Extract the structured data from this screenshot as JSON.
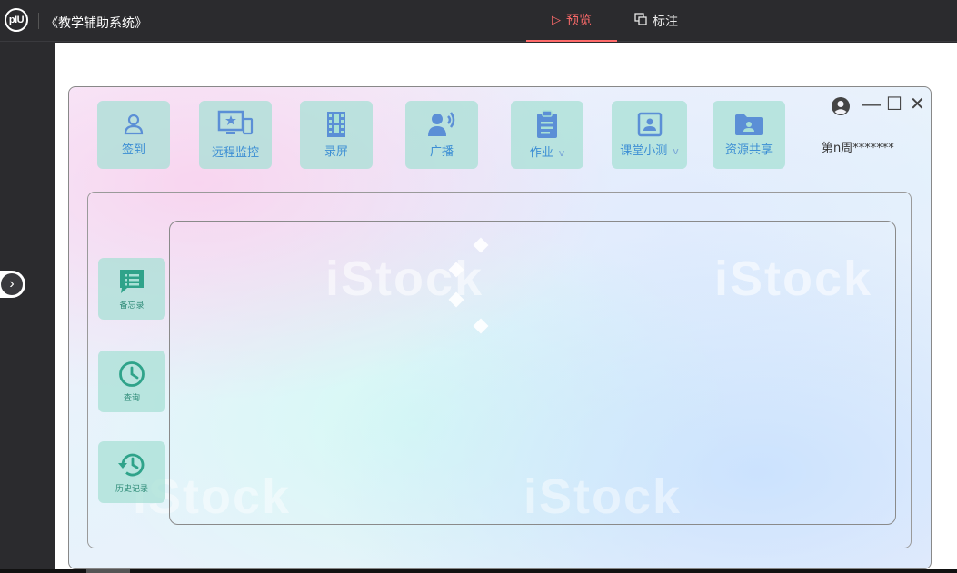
{
  "app": {
    "logo": "pIU",
    "title": "《教学辅助系统》"
  },
  "tabs": [
    {
      "label": "预览",
      "icon": "play-icon",
      "active": true
    },
    {
      "label": "标注",
      "icon": "annotate-icon",
      "active": false
    }
  ],
  "colors": {
    "accent": "#ff6b6b",
    "tool_bg": "#a8e0d6",
    "tool_icon": "#5b8fd6",
    "side_icon": "#2fa38a"
  },
  "toolbar": {
    "items": [
      {
        "label": "签到",
        "icon": "user-icon"
      },
      {
        "label": "远程监控",
        "icon": "monitor-icon"
      },
      {
        "label": "录屏",
        "icon": "film-icon"
      },
      {
        "label": "广播",
        "icon": "broadcast-icon"
      },
      {
        "label": "作业",
        "icon": "clipboard-icon",
        "dropdown": "v"
      },
      {
        "label": "课堂小测",
        "icon": "quiz-icon",
        "dropdown": "v"
      },
      {
        "label": "资源共享",
        "icon": "folder-user-icon"
      }
    ],
    "week_label": "第n周*******"
  },
  "window_controls": {
    "minimize": "—",
    "maximize": "☐",
    "close": "✕"
  },
  "side_tools": [
    {
      "label": "备忘录",
      "icon": "memo-icon"
    },
    {
      "label": "查询",
      "icon": "clock-icon"
    },
    {
      "label": "历史记录",
      "icon": "history-icon"
    }
  ]
}
